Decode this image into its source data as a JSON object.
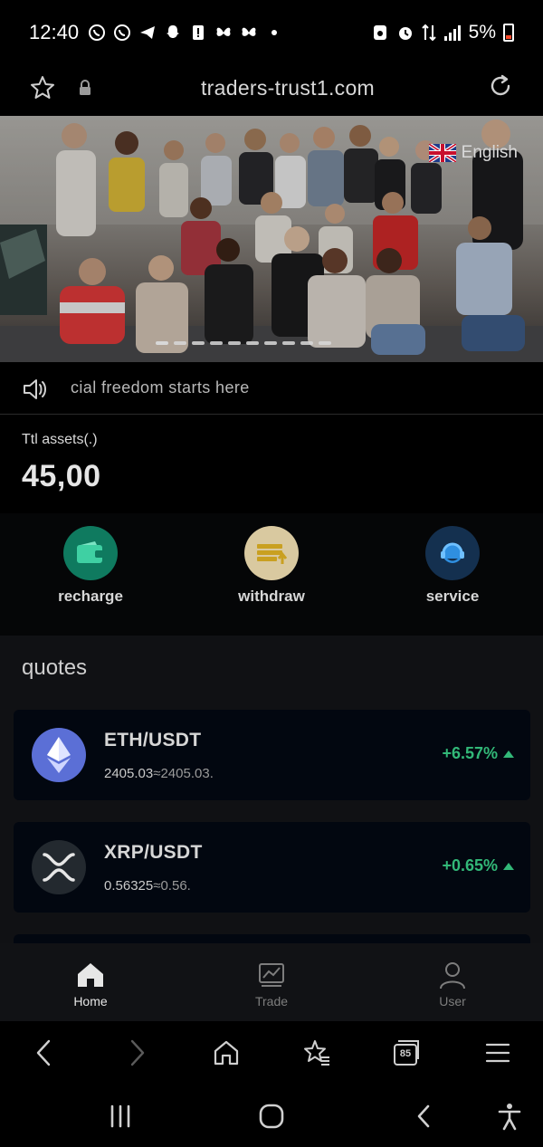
{
  "status_bar": {
    "time": "12:40",
    "battery_percent": "5%"
  },
  "browser": {
    "url": "traders-trust1.com",
    "tab_count": "85"
  },
  "banner": {
    "language": "English",
    "slide_count": 10,
    "active_slide": 0
  },
  "notice": {
    "text": "cial freedom starts here"
  },
  "assets": {
    "label": "Ttl assets(.)",
    "value": "45,00"
  },
  "actions": [
    {
      "label": "recharge",
      "icon": "wallet-icon",
      "color": "#0f7a5f"
    },
    {
      "label": "withdraw",
      "icon": "withdraw-icon",
      "color": "#d9c9a0"
    },
    {
      "label": "service",
      "icon": "headset-icon",
      "color": "#14304f"
    }
  ],
  "quotes": {
    "title": "quotes",
    "items": [
      {
        "pair": "ETH/USDT",
        "price": "2405.03",
        "approx": "≈2405.03.",
        "change": "+6.57%",
        "icon": "ethereum-icon",
        "color": "#5b6fd6"
      },
      {
        "pair": "XRP/USDT",
        "price": "0.56325",
        "approx": "≈0.56.",
        "change": "+0.65%",
        "icon": "xrp-icon",
        "color": "#23292f"
      }
    ]
  },
  "tabbar": {
    "items": [
      {
        "label": "Home",
        "icon": "home-icon",
        "active": true
      },
      {
        "label": "Trade",
        "icon": "chart-icon",
        "active": false
      },
      {
        "label": "User",
        "icon": "user-icon",
        "active": false
      }
    ]
  },
  "colors": {
    "positive": "#32b878",
    "active_tab": "#e6e6e6",
    "inactive_tab": "#7d7d7d"
  }
}
